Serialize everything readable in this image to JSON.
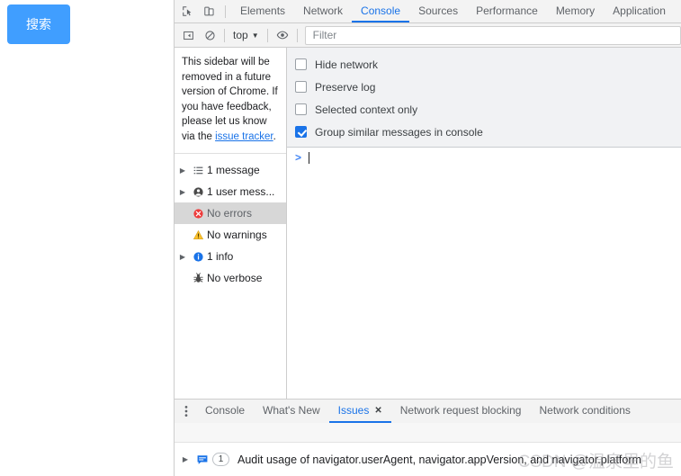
{
  "page": {
    "search_button_label": "搜索"
  },
  "devtools": {
    "main_tabs": [
      {
        "label": "Elements",
        "active": false
      },
      {
        "label": "Network",
        "active": false
      },
      {
        "label": "Console",
        "active": true
      },
      {
        "label": "Sources",
        "active": false
      },
      {
        "label": "Performance",
        "active": false
      },
      {
        "label": "Memory",
        "active": false
      },
      {
        "label": "Application",
        "active": false
      }
    ],
    "toolbar_icons": [
      {
        "name": "inspect-element-icon"
      },
      {
        "name": "device-toolbar-icon"
      }
    ],
    "console_toolbar": {
      "sidebar_toggle_name": "console-sidebar-toggle-icon",
      "clear_console_name": "clear-console-icon",
      "context_label": "top",
      "context_caret": "▼",
      "eye_icon_name": "live-expression-eye-icon",
      "filter_placeholder": "Filter",
      "filter_value": ""
    },
    "console_sidebar": {
      "notice_text_1": "This sidebar will be removed in a future version of Chrome. If you have feedback, please let us know via the ",
      "notice_link": "issue tracker",
      "notice_text_2": ".",
      "tree": [
        {
          "label": "1 message",
          "icon": "list-icon",
          "arrow": true,
          "selected": false
        },
        {
          "label": "1 user mess...",
          "icon": "user-icon",
          "arrow": true,
          "selected": false
        },
        {
          "label": "No errors",
          "icon": "error-icon",
          "arrow": false,
          "selected": true
        },
        {
          "label": "No warnings",
          "icon": "warning-icon",
          "arrow": false,
          "selected": false
        },
        {
          "label": "1 info",
          "icon": "info-icon",
          "arrow": true,
          "selected": false
        },
        {
          "label": "No verbose",
          "icon": "verbose-bug-icon",
          "arrow": false,
          "selected": false
        }
      ]
    },
    "console_settings": [
      {
        "label": "Hide network",
        "checked": false
      },
      {
        "label": "Preserve log",
        "checked": false
      },
      {
        "label": "Selected context only",
        "checked": false
      },
      {
        "label": "Group similar messages in console",
        "checked": true
      }
    ],
    "console_prompt": {
      "chevron": ">",
      "value": ""
    },
    "drawer": {
      "menu_icon": "more-options-icon",
      "tabs": [
        {
          "label": "Console",
          "active": false,
          "closable": false
        },
        {
          "label": "What's New",
          "active": false,
          "closable": false
        },
        {
          "label": "Issues",
          "active": true,
          "closable": true,
          "close_glyph": "✕"
        },
        {
          "label": "Network request blocking",
          "active": false,
          "closable": false
        },
        {
          "label": "Network conditions",
          "active": false,
          "closable": false
        }
      ],
      "issue": {
        "arrow": "▶",
        "icon": "issue-message-icon",
        "count": "1",
        "text": "Audit usage of navigator.userAgent, navigator.appVersion, and navigator.platform"
      }
    }
  },
  "watermark": {
    "text": "CSDN @温泉里的鱼"
  },
  "colors": {
    "accent_blue": "#1a73e8",
    "button_blue": "#409eff",
    "error_red": "#ee3b3b",
    "warning_yellow": "#fbc02d",
    "info_blue": "#1a73e8",
    "toolbar_bg": "#f3f3f3",
    "settings_bg": "#f1f2f4",
    "selected_row": "#d7d7d7"
  }
}
